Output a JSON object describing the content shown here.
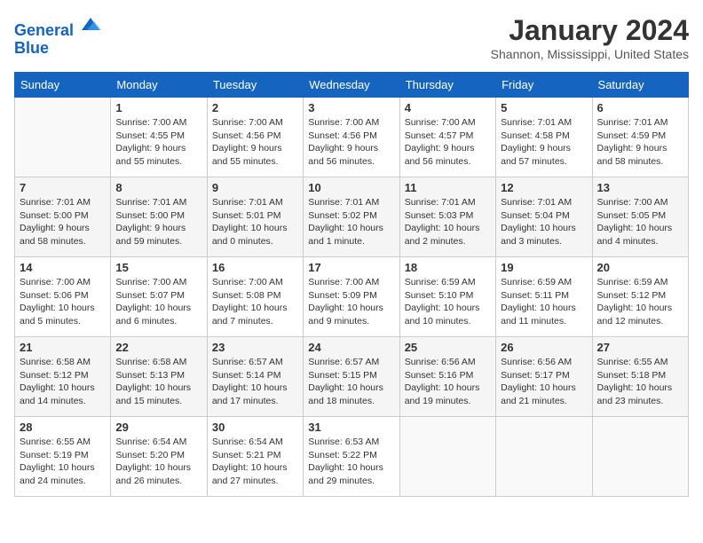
{
  "header": {
    "logo_line1": "General",
    "logo_line2": "Blue",
    "title": "January 2024",
    "subtitle": "Shannon, Mississippi, United States"
  },
  "days_of_week": [
    "Sunday",
    "Monday",
    "Tuesday",
    "Wednesday",
    "Thursday",
    "Friday",
    "Saturday"
  ],
  "weeks": [
    [
      {
        "day": "",
        "info": ""
      },
      {
        "day": "1",
        "info": "Sunrise: 7:00 AM\nSunset: 4:55 PM\nDaylight: 9 hours\nand 55 minutes."
      },
      {
        "day": "2",
        "info": "Sunrise: 7:00 AM\nSunset: 4:56 PM\nDaylight: 9 hours\nand 55 minutes."
      },
      {
        "day": "3",
        "info": "Sunrise: 7:00 AM\nSunset: 4:56 PM\nDaylight: 9 hours\nand 56 minutes."
      },
      {
        "day": "4",
        "info": "Sunrise: 7:00 AM\nSunset: 4:57 PM\nDaylight: 9 hours\nand 56 minutes."
      },
      {
        "day": "5",
        "info": "Sunrise: 7:01 AM\nSunset: 4:58 PM\nDaylight: 9 hours\nand 57 minutes."
      },
      {
        "day": "6",
        "info": "Sunrise: 7:01 AM\nSunset: 4:59 PM\nDaylight: 9 hours\nand 58 minutes."
      }
    ],
    [
      {
        "day": "7",
        "info": "Sunrise: 7:01 AM\nSunset: 5:00 PM\nDaylight: 9 hours\nand 58 minutes."
      },
      {
        "day": "8",
        "info": "Sunrise: 7:01 AM\nSunset: 5:00 PM\nDaylight: 9 hours\nand 59 minutes."
      },
      {
        "day": "9",
        "info": "Sunrise: 7:01 AM\nSunset: 5:01 PM\nDaylight: 10 hours\nand 0 minutes."
      },
      {
        "day": "10",
        "info": "Sunrise: 7:01 AM\nSunset: 5:02 PM\nDaylight: 10 hours\nand 1 minute."
      },
      {
        "day": "11",
        "info": "Sunrise: 7:01 AM\nSunset: 5:03 PM\nDaylight: 10 hours\nand 2 minutes."
      },
      {
        "day": "12",
        "info": "Sunrise: 7:01 AM\nSunset: 5:04 PM\nDaylight: 10 hours\nand 3 minutes."
      },
      {
        "day": "13",
        "info": "Sunrise: 7:00 AM\nSunset: 5:05 PM\nDaylight: 10 hours\nand 4 minutes."
      }
    ],
    [
      {
        "day": "14",
        "info": "Sunrise: 7:00 AM\nSunset: 5:06 PM\nDaylight: 10 hours\nand 5 minutes."
      },
      {
        "day": "15",
        "info": "Sunrise: 7:00 AM\nSunset: 5:07 PM\nDaylight: 10 hours\nand 6 minutes."
      },
      {
        "day": "16",
        "info": "Sunrise: 7:00 AM\nSunset: 5:08 PM\nDaylight: 10 hours\nand 7 minutes."
      },
      {
        "day": "17",
        "info": "Sunrise: 7:00 AM\nSunset: 5:09 PM\nDaylight: 10 hours\nand 9 minutes."
      },
      {
        "day": "18",
        "info": "Sunrise: 6:59 AM\nSunset: 5:10 PM\nDaylight: 10 hours\nand 10 minutes."
      },
      {
        "day": "19",
        "info": "Sunrise: 6:59 AM\nSunset: 5:11 PM\nDaylight: 10 hours\nand 11 minutes."
      },
      {
        "day": "20",
        "info": "Sunrise: 6:59 AM\nSunset: 5:12 PM\nDaylight: 10 hours\nand 12 minutes."
      }
    ],
    [
      {
        "day": "21",
        "info": "Sunrise: 6:58 AM\nSunset: 5:12 PM\nDaylight: 10 hours\nand 14 minutes."
      },
      {
        "day": "22",
        "info": "Sunrise: 6:58 AM\nSunset: 5:13 PM\nDaylight: 10 hours\nand 15 minutes."
      },
      {
        "day": "23",
        "info": "Sunrise: 6:57 AM\nSunset: 5:14 PM\nDaylight: 10 hours\nand 17 minutes."
      },
      {
        "day": "24",
        "info": "Sunrise: 6:57 AM\nSunset: 5:15 PM\nDaylight: 10 hours\nand 18 minutes."
      },
      {
        "day": "25",
        "info": "Sunrise: 6:56 AM\nSunset: 5:16 PM\nDaylight: 10 hours\nand 19 minutes."
      },
      {
        "day": "26",
        "info": "Sunrise: 6:56 AM\nSunset: 5:17 PM\nDaylight: 10 hours\nand 21 minutes."
      },
      {
        "day": "27",
        "info": "Sunrise: 6:55 AM\nSunset: 5:18 PM\nDaylight: 10 hours\nand 23 minutes."
      }
    ],
    [
      {
        "day": "28",
        "info": "Sunrise: 6:55 AM\nSunset: 5:19 PM\nDaylight: 10 hours\nand 24 minutes."
      },
      {
        "day": "29",
        "info": "Sunrise: 6:54 AM\nSunset: 5:20 PM\nDaylight: 10 hours\nand 26 minutes."
      },
      {
        "day": "30",
        "info": "Sunrise: 6:54 AM\nSunset: 5:21 PM\nDaylight: 10 hours\nand 27 minutes."
      },
      {
        "day": "31",
        "info": "Sunrise: 6:53 AM\nSunset: 5:22 PM\nDaylight: 10 hours\nand 29 minutes."
      },
      {
        "day": "",
        "info": ""
      },
      {
        "day": "",
        "info": ""
      },
      {
        "day": "",
        "info": ""
      }
    ]
  ]
}
